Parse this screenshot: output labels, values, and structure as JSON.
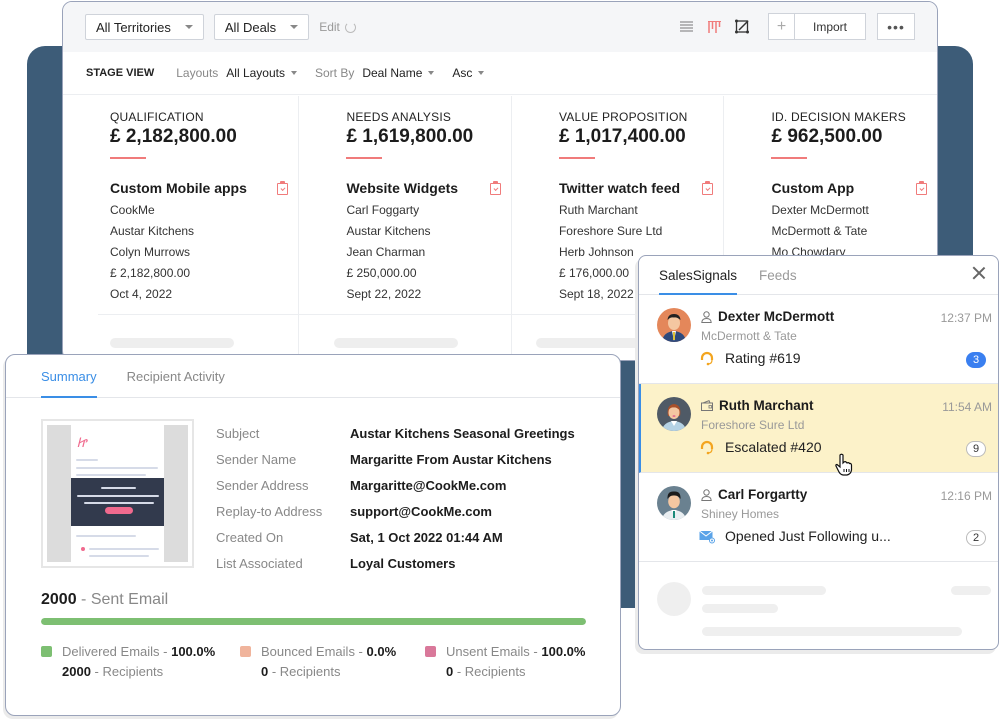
{
  "toolbar": {
    "territory_filter": "All Territories",
    "deals_filter": "All Deals",
    "edit_label": "Edit",
    "import_label": "Import",
    "more_label": "•••",
    "view_icons": [
      "list-view-icon",
      "kanban-view-icon",
      "canvas-view-icon"
    ]
  },
  "subbar": {
    "stage_view": "STAGE VIEW",
    "layouts_label": "Layouts",
    "layouts_value": "All Layouts",
    "sort_label": "Sort By",
    "sort_value": "Deal Name",
    "order_value": "Asc"
  },
  "stages": [
    {
      "name": "QUALIFICATION",
      "total": "£ 2,182,800.00",
      "deal": {
        "title": "Custom Mobile apps",
        "lines": [
          "CookMe",
          "Austar Kitchens",
          "Colyn Murrows",
          "£ 2,182,800.00",
          "Oct 4, 2022"
        ]
      }
    },
    {
      "name": "NEEDS ANALYSIS",
      "total": "£ 1,619,800.00",
      "deal": {
        "title": "Website Widgets",
        "lines": [
          "Carl Foggarty",
          "Austar Kitchens",
          "Jean Charman",
          "£ 250,000.00",
          "Sept 22, 2022"
        ]
      }
    },
    {
      "name": "VALUE PROPOSITION",
      "total": "£ 1,017,400.00",
      "deal": {
        "title": "Twitter watch feed",
        "lines": [
          "Ruth Marchant",
          "Foreshore Sure Ltd",
          "Herb Johnson",
          "£ 176,000.00",
          "Sept 18, 2022"
        ]
      }
    },
    {
      "name": "ID. DECISION MAKERS",
      "total": "£ 962,500.00",
      "deal": {
        "title": "Custom App",
        "lines": [
          "Dexter McDermott",
          "McDermott & Tate",
          "Mo Chowdary",
          "",
          ""
        ]
      }
    }
  ],
  "summary": {
    "tabs": [
      "Summary",
      "Recipient Activity"
    ],
    "active_tab": "Summary",
    "fields": [
      {
        "label": "Subject",
        "value": "Austar Kitchens Seasonal Greetings"
      },
      {
        "label": "Sender Name",
        "value": "Margaritte From Austar Kitchens"
      },
      {
        "label": "Sender Address",
        "value": "Margaritte@CookMe.com"
      },
      {
        "label": "Replay-to Address",
        "value": "support@CookMe.com"
      },
      {
        "label": "Created On",
        "value": "Sat, 1 Oct 2022 01:44 AM"
      },
      {
        "label": "List Associated",
        "value": "Loyal Customers"
      }
    ],
    "sent_count": "2000",
    "sent_label": "- Sent Email",
    "delivered_fraction": 1.0,
    "legend": [
      {
        "label": "Delivered Emails - ",
        "pct": "100.0%",
        "count": "2000",
        "count_label": " - Recipients",
        "color": "#7dbf72"
      },
      {
        "label": "Bounced Emails - ",
        "pct": "0.0%",
        "count": "0",
        "count_label": " - Recipients",
        "color": "#f0b49c"
      },
      {
        "label": "Unsent Emails - ",
        "pct": "100.0%",
        "count": "0",
        "count_label": " - Recipients",
        "color": "#d9789a"
      }
    ]
  },
  "signals": {
    "tabs": [
      "SalesSignals",
      "Feeds"
    ],
    "active_tab": "SalesSignals",
    "items": [
      {
        "name": "Dexter McDermott",
        "company": "McDermott & Tate",
        "time": "12:37 PM",
        "message": "Rating #619",
        "badge": "3",
        "type_icon": "contact-icon",
        "msg_icon": "support-headset-icon"
      },
      {
        "name": "Ruth Marchant",
        "company": "Foreshore Sure Ltd",
        "time": "11:54 AM",
        "message": "Escalated #420",
        "badge": "9",
        "type_icon": "account-icon",
        "msg_icon": "support-headset-icon"
      },
      {
        "name": "Carl Forgartty",
        "company": "Shiney Homes",
        "time": "12:16 PM",
        "message": "Opened Just Following u...",
        "badge": "2",
        "type_icon": "contact-icon",
        "msg_icon": "email-opened-icon"
      }
    ]
  },
  "colors": {
    "accent_blue": "#3a8ee6",
    "stage_underline": "#f07b7b",
    "backdrop": "#3d5c78",
    "highlight_row": "#fcf2c9",
    "progress_green": "#7dbf72"
  }
}
